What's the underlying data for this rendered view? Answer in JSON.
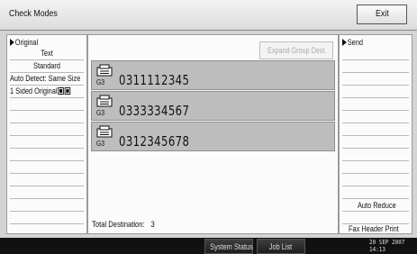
{
  "header": {
    "title": "Check Modes",
    "exit_label": "Exit"
  },
  "left_panel": {
    "heading": "Original",
    "items": [
      "Text",
      "Standard",
      "Auto Detect: Same Size",
      "1 Sided Original"
    ]
  },
  "center_panel": {
    "expand_label": "Expand Group Dest.",
    "destinations": [
      {
        "mode": "G3",
        "number": "0311112345"
      },
      {
        "mode": "G3",
        "number": "0333334567"
      },
      {
        "mode": "G3",
        "number": "0312345678"
      }
    ],
    "total_label": "Total Destination:",
    "total_value": "3"
  },
  "right_panel": {
    "heading": "Send",
    "items": [
      "Auto Reduce",
      "Fax Header Print"
    ]
  },
  "taskbar": {
    "system_status": "System Status",
    "job_list": "Job List",
    "date": "20 SEP  2007",
    "time": "14:13"
  },
  "colors": {
    "selected_row": "#bdbdbd",
    "panel": "#fbfbfb",
    "background": "#d4d4d4"
  },
  "icons": [
    "fax-icon",
    "triangle-marker-icon",
    "original-orientation-icon"
  ]
}
